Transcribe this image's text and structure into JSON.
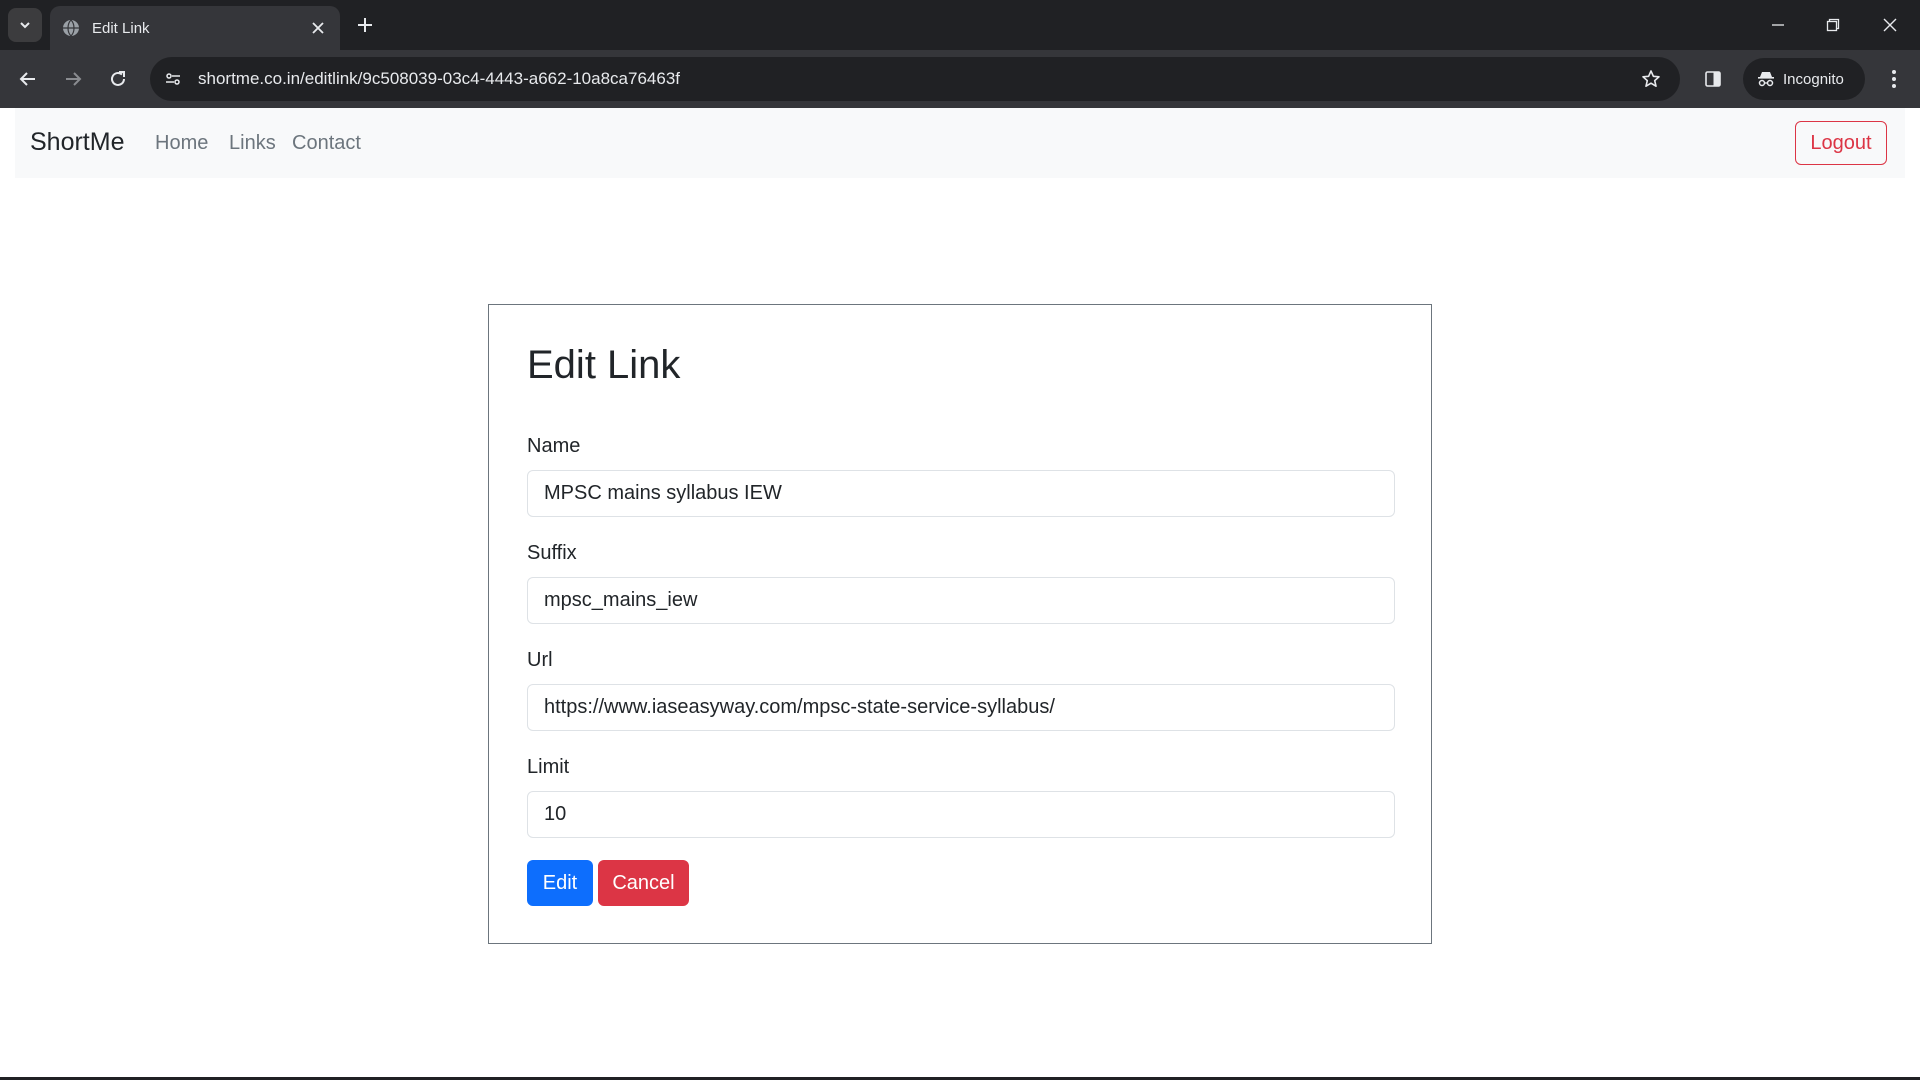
{
  "browser": {
    "tab_title": "Edit Link",
    "url": "shortme.co.in/editlink/9c508039-03c4-4443-a662-10a8ca76463f",
    "profile_label": "Incognito"
  },
  "navbar": {
    "brand": "ShortMe",
    "links": [
      "Home",
      "Links",
      "Contact"
    ],
    "logout_label": "Logout"
  },
  "form": {
    "title": "Edit Link",
    "fields": [
      {
        "label": "Name",
        "value": "MPSC mains syllabus IEW"
      },
      {
        "label": "Suffix",
        "value": "mpsc_mains_iew"
      },
      {
        "label": "Url",
        "value": "https://www.iaseasyway.com/mpsc-state-service-syllabus/"
      },
      {
        "label": "Limit",
        "value": "10"
      }
    ],
    "edit_label": "Edit",
    "cancel_label": "Cancel"
  },
  "colors": {
    "primary": "#0d6efd",
    "danger": "#dc3545",
    "navbar_bg": "#f8f9fa",
    "chrome_dark": "#202124"
  },
  "icons": [
    "tab-search-icon",
    "globe-icon",
    "close-icon",
    "plus-icon",
    "minimize-icon",
    "restore-icon",
    "back-arrow-icon",
    "forward-arrow-icon",
    "reload-icon",
    "site-info-icon",
    "star-icon",
    "side-panel-icon",
    "incognito-icon",
    "more-vert-icon"
  ]
}
